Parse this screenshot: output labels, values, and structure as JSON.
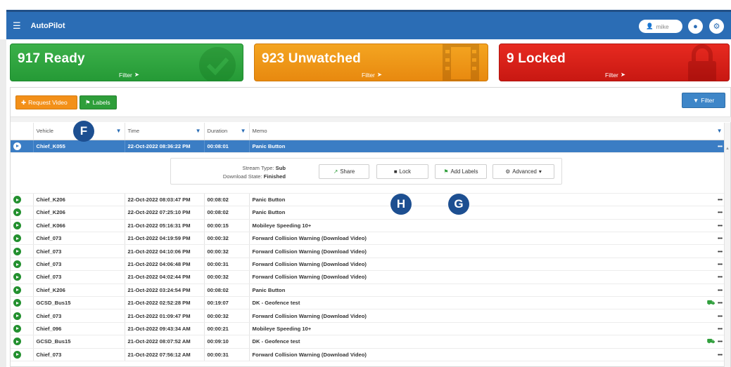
{
  "app": {
    "title": "AutoPilot",
    "user": "mike"
  },
  "cards": {
    "ready": {
      "count": "917 Ready",
      "filter": "Filter"
    },
    "unwatched": {
      "count": "923 Unwatched",
      "filter": "Filter"
    },
    "locked": {
      "count": "9 Locked",
      "filter": "Filter"
    }
  },
  "toolbar": {
    "request_video": "Request Video",
    "labels": "Labels",
    "filter": "Filter"
  },
  "columns": {
    "vehicle": "Vehicle",
    "time": "Time",
    "duration": "Duration",
    "memo": "Memo"
  },
  "selected_row": {
    "vehicle": "Chief_K055",
    "time": "22-Oct-2022 08:36:22 PM",
    "duration": "00:08:01",
    "memo": "Panic Button",
    "actions": "•••"
  },
  "detail": {
    "stream_type_label": "Stream Type:",
    "stream_type": "Sub",
    "download_state_label": "Download State:",
    "download_state": "Finished",
    "share": "Share",
    "lock": "Lock",
    "add_labels": "Add Labels",
    "advanced": "Advanced"
  },
  "rows": [
    {
      "vehicle": "Chief_K206",
      "time": "22-Oct-2022 08:03:47 PM",
      "duration": "00:08:02",
      "memo": "Panic Button",
      "actions": "•••"
    },
    {
      "vehicle": "Chief_K206",
      "time": "22-Oct-2022 07:25:10 PM",
      "duration": "00:08:02",
      "memo": "Panic Button",
      "actions": "•••"
    },
    {
      "vehicle": "Chief_K066",
      "time": "21-Oct-2022 05:16:31 PM",
      "duration": "00:00:15",
      "memo": "Mobileye Speeding 10+",
      "actions": "•••"
    },
    {
      "vehicle": "Chief_073",
      "time": "21-Oct-2022 04:19:59 PM",
      "duration": "00:00:32",
      "memo": "Forward Collision Warning (Download Video)",
      "actions": "•••"
    },
    {
      "vehicle": "Chief_073",
      "time": "21-Oct-2022 04:10:06 PM",
      "duration": "00:00:32",
      "memo": "Forward Collision Warning (Download Video)",
      "actions": "•••"
    },
    {
      "vehicle": "Chief_073",
      "time": "21-Oct-2022 04:06:48 PM",
      "duration": "00:00:31",
      "memo": "Forward Collision Warning (Download Video)",
      "actions": "•••"
    },
    {
      "vehicle": "Chief_073",
      "time": "21-Oct-2022 04:02:44 PM",
      "duration": "00:00:32",
      "memo": "Forward Collision Warning (Download Video)",
      "actions": "•••"
    },
    {
      "vehicle": "Chief_K206",
      "time": "21-Oct-2022 03:24:54 PM",
      "duration": "00:08:02",
      "memo": "Panic Button",
      "actions": "•••"
    },
    {
      "vehicle": "GCSD_Bus15",
      "time": "21-Oct-2022 02:52:28 PM",
      "duration": "00:19:07",
      "memo": "DK - Geofence test",
      "actions": "•••"
    },
    {
      "vehicle": "Chief_073",
      "time": "21-Oct-2022 01:09:47 PM",
      "duration": "00:00:32",
      "memo": "Forward Collision Warning (Download Video)",
      "actions": "•••"
    },
    {
      "vehicle": "Chief_096",
      "time": "21-Oct-2022 09:43:34 AM",
      "duration": "00:00:21",
      "memo": "Mobileye Speeding 10+",
      "actions": "•••"
    },
    {
      "vehicle": "GCSD_Bus15",
      "time": "21-Oct-2022 08:07:52 AM",
      "duration": "00:09:10",
      "memo": "DK - Geofence test",
      "actions": "•••"
    },
    {
      "vehicle": "Chief_073",
      "time": "21-Oct-2022 07:56:12 AM",
      "duration": "00:00:31",
      "memo": "Forward Collision Warning (Download Video)",
      "actions": "•••"
    }
  ],
  "markers": {
    "f": "F",
    "h": "H",
    "g": "G"
  },
  "icons": {
    "menu": "hamburger-icon",
    "user": "user-icon",
    "bell": "bell-icon",
    "settings": "gear-icon",
    "ready": "check-circle-icon",
    "unwatched": "film-icon",
    "locked": "lock-icon",
    "play": "play-icon",
    "truck": "truck-icon",
    "funnel": "funnel-icon"
  },
  "colors": {
    "header": "#2b6db5",
    "ready": "#2ea23d",
    "unwatched": "#f0981a",
    "locked": "#d8221a",
    "selected": "#3b7dc4",
    "marker": "#1d4f91"
  }
}
